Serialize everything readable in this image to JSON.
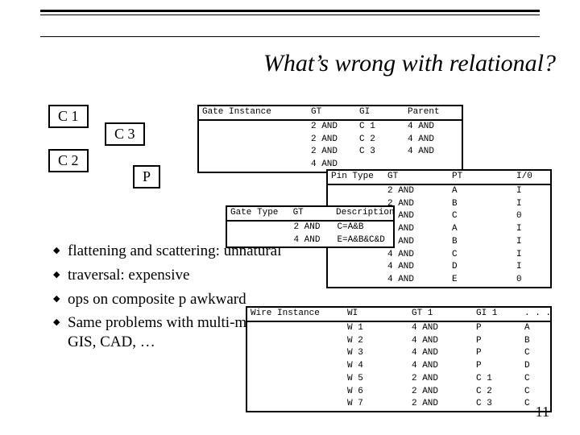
{
  "title": "What’s wrong with relational?",
  "page_number": "11",
  "diagram": {
    "c1": "C 1",
    "c2": "C 2",
    "c3": "C 3",
    "p": "P"
  },
  "bullets": [
    "flattening and scattering: unnatural",
    "traversal: expensive",
    "ops on composite p awkward",
    "Same problems with multi-media, GIS, CAD, …"
  ],
  "tables": {
    "gate_instance": {
      "name": "Gate Instance",
      "headers": [
        "Gate Instance",
        "GT",
        "GI",
        "Parent"
      ],
      "rows": [
        [
          "",
          "2 AND",
          "C 1",
          "4 AND"
        ],
        [
          "",
          "2 AND",
          "C 2",
          "4 AND"
        ],
        [
          "",
          "2 AND",
          "C 3",
          "4 AND"
        ],
        [
          "",
          "4 AND",
          "",
          ""
        ]
      ]
    },
    "pin_type": {
      "name": "Pin Type",
      "headers": [
        "Pin Type",
        "GT",
        "PT",
        "I/0"
      ],
      "rows": [
        [
          "",
          "2 AND",
          "A",
          "I"
        ],
        [
          "",
          "2 AND",
          "B",
          "I"
        ],
        [
          "",
          "2 AND",
          "C",
          "0"
        ],
        [
          "",
          "4 AND",
          "A",
          "I"
        ],
        [
          "",
          "4 AND",
          "B",
          "I"
        ],
        [
          "",
          "4 AND",
          "C",
          "I"
        ],
        [
          "",
          "4 AND",
          "D",
          "I"
        ],
        [
          "",
          "4 AND",
          "E",
          "0"
        ]
      ]
    },
    "gate_type": {
      "name": "Gate Type",
      "headers": [
        "Gate Type",
        "GT",
        "Description"
      ],
      "rows": [
        [
          "",
          "2 AND",
          "C=A&B"
        ],
        [
          "",
          "4 AND",
          "E=A&B&C&D"
        ]
      ]
    },
    "wire_instance": {
      "name": "Wire Instance",
      "headers": [
        "Wire Instance",
        "WI",
        "GT 1",
        "GI 1",
        ". . ."
      ],
      "rows": [
        [
          "",
          "W 1",
          "4 AND",
          "P",
          "A"
        ],
        [
          "",
          "W 2",
          "4 AND",
          "P",
          "B"
        ],
        [
          "",
          "W 3",
          "4 AND",
          "P",
          "C"
        ],
        [
          "",
          "W 4",
          "4 AND",
          "P",
          "D"
        ],
        [
          "",
          "W 5",
          "2 AND",
          "C 1",
          "C"
        ],
        [
          "",
          "W 6",
          "2 AND",
          "C 2",
          "C"
        ],
        [
          "",
          "W 7",
          "2 AND",
          "C 3",
          "C"
        ]
      ]
    }
  }
}
